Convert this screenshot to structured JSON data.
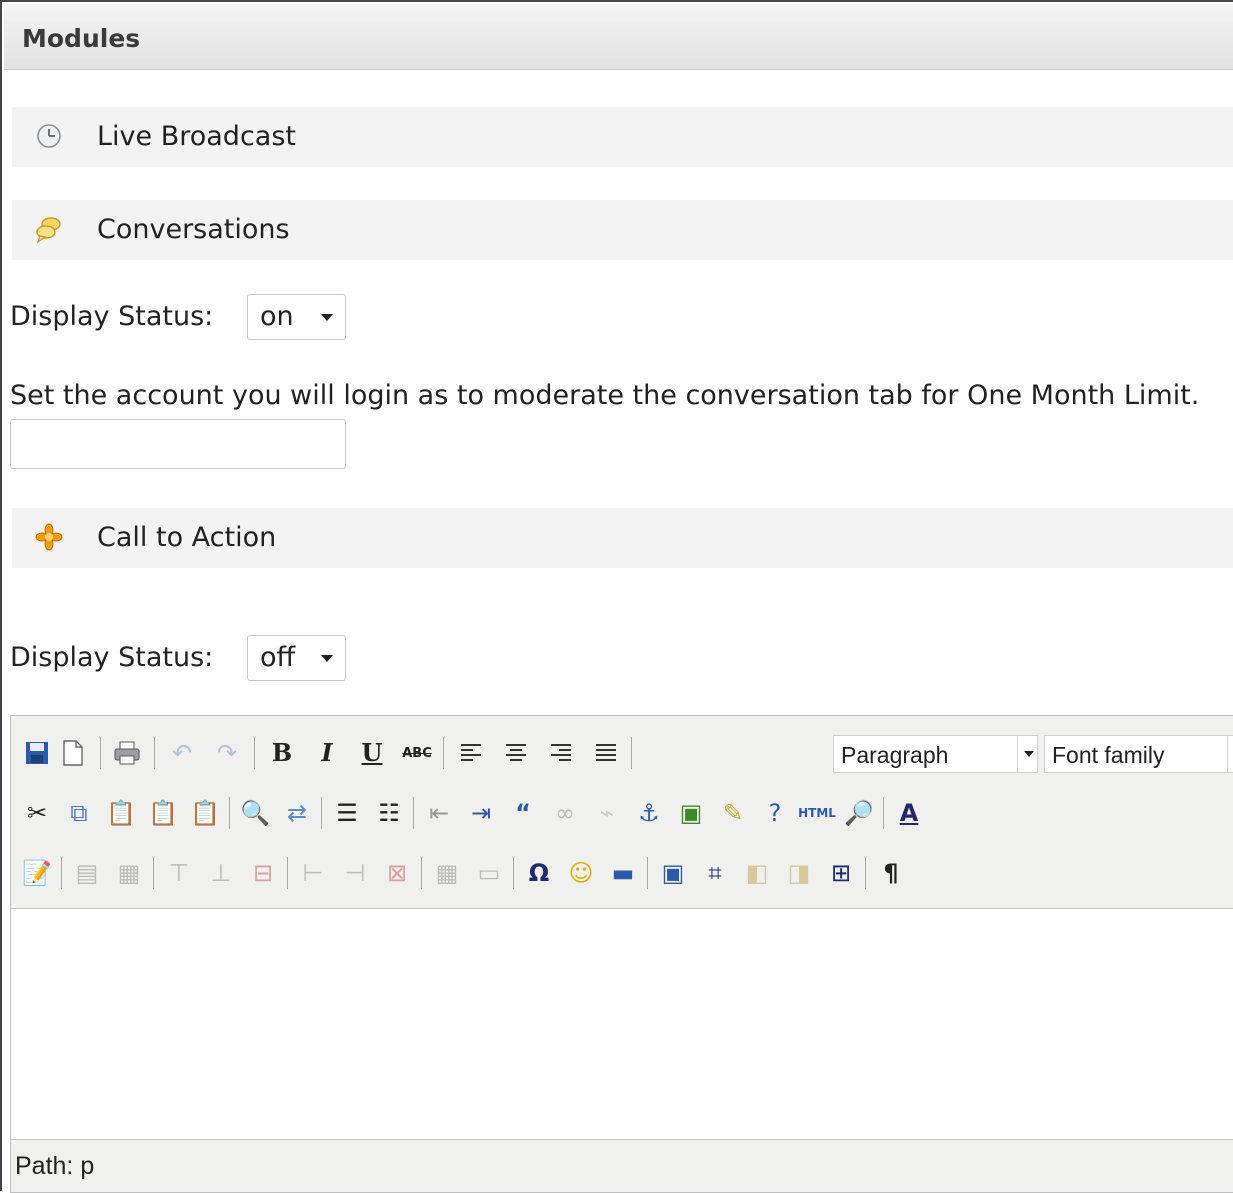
{
  "header": {
    "title": "Modules"
  },
  "live_broadcast": {
    "title": "Live Broadcast",
    "icon": "clock-icon"
  },
  "conversations": {
    "title": "Conversations",
    "icon": "speech-bubbles-icon",
    "display_status_label": "Display Status:",
    "display_status_value": "on",
    "moderator_help": "Set the account you will login as to moderate the conversation tab for One Month Limit.",
    "moderator_value": ""
  },
  "call_to_action": {
    "title": "Call to Action",
    "icon": "asterisk-icon",
    "display_status_label": "Display Status:",
    "display_status_value": "off"
  },
  "editor": {
    "format_select": "Paragraph",
    "font_select": "Font family",
    "status_path": "Path: p",
    "toolbar_row1": [
      "save-icon",
      "new-document-icon",
      "print-icon",
      "undo-icon",
      "redo-icon",
      "bold-icon",
      "italic-icon",
      "underline-icon",
      "strikethrough-icon",
      "align-left-icon",
      "align-center-icon",
      "align-right-icon",
      "align-justify-icon"
    ],
    "toolbar_row2": [
      "cut-icon",
      "copy-icon",
      "paste-icon",
      "paste-text-icon",
      "paste-word-icon",
      "find-icon",
      "replace-icon",
      "bullet-list-icon",
      "numbered-list-icon",
      "outdent-icon",
      "indent-icon",
      "blockquote-icon",
      "link-icon",
      "unlink-icon",
      "anchor-icon",
      "image-icon",
      "cleanup-icon",
      "help-icon",
      "html-source-icon",
      "preview-icon",
      "text-color-icon"
    ],
    "toolbar_row3": [
      "edit-css-icon",
      "row-props-icon",
      "cell-props-icon",
      "insert-row-before-icon",
      "insert-row-after-icon",
      "delete-row-icon",
      "insert-col-before-icon",
      "insert-col-after-icon",
      "delete-col-icon",
      "split-cells-icon",
      "merge-cells-icon",
      "special-char-icon",
      "emoticon-icon",
      "horizontal-rule-icon",
      "layer-icon",
      "absolute-icon",
      "move-forward-icon",
      "move-backward-icon",
      "insert-layer-icon",
      "visual-chars-icon"
    ]
  }
}
